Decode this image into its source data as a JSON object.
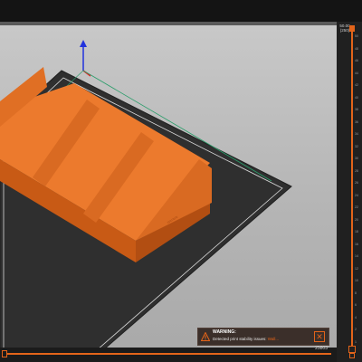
{
  "warning": {
    "title": "WARNING:",
    "message": "Detected print stability issues:",
    "link_text": "Wall..."
  },
  "horizontal_slider": {
    "value_label": "25803"
  },
  "vertical_slider": {
    "top_value": "50.00",
    "top_layer": "(250)",
    "ticks": [
      "50",
      "48",
      "46",
      "44",
      "42",
      "40",
      "38",
      "36",
      "34",
      "32",
      "30",
      "28",
      "26",
      "24",
      "22",
      "20",
      "18",
      "16",
      "14",
      "12",
      "10",
      "8",
      "6",
      "4",
      "2",
      "1"
    ]
  },
  "colors": {
    "accent": "#e3641a",
    "model": "#ec7a2d",
    "bed": "#2e2e2e",
    "viewport_bg": "#b5b5b5"
  },
  "icons": {
    "warning": "warning-triangle-icon",
    "close": "close-x-icon",
    "lock": "lock-icon"
  }
}
